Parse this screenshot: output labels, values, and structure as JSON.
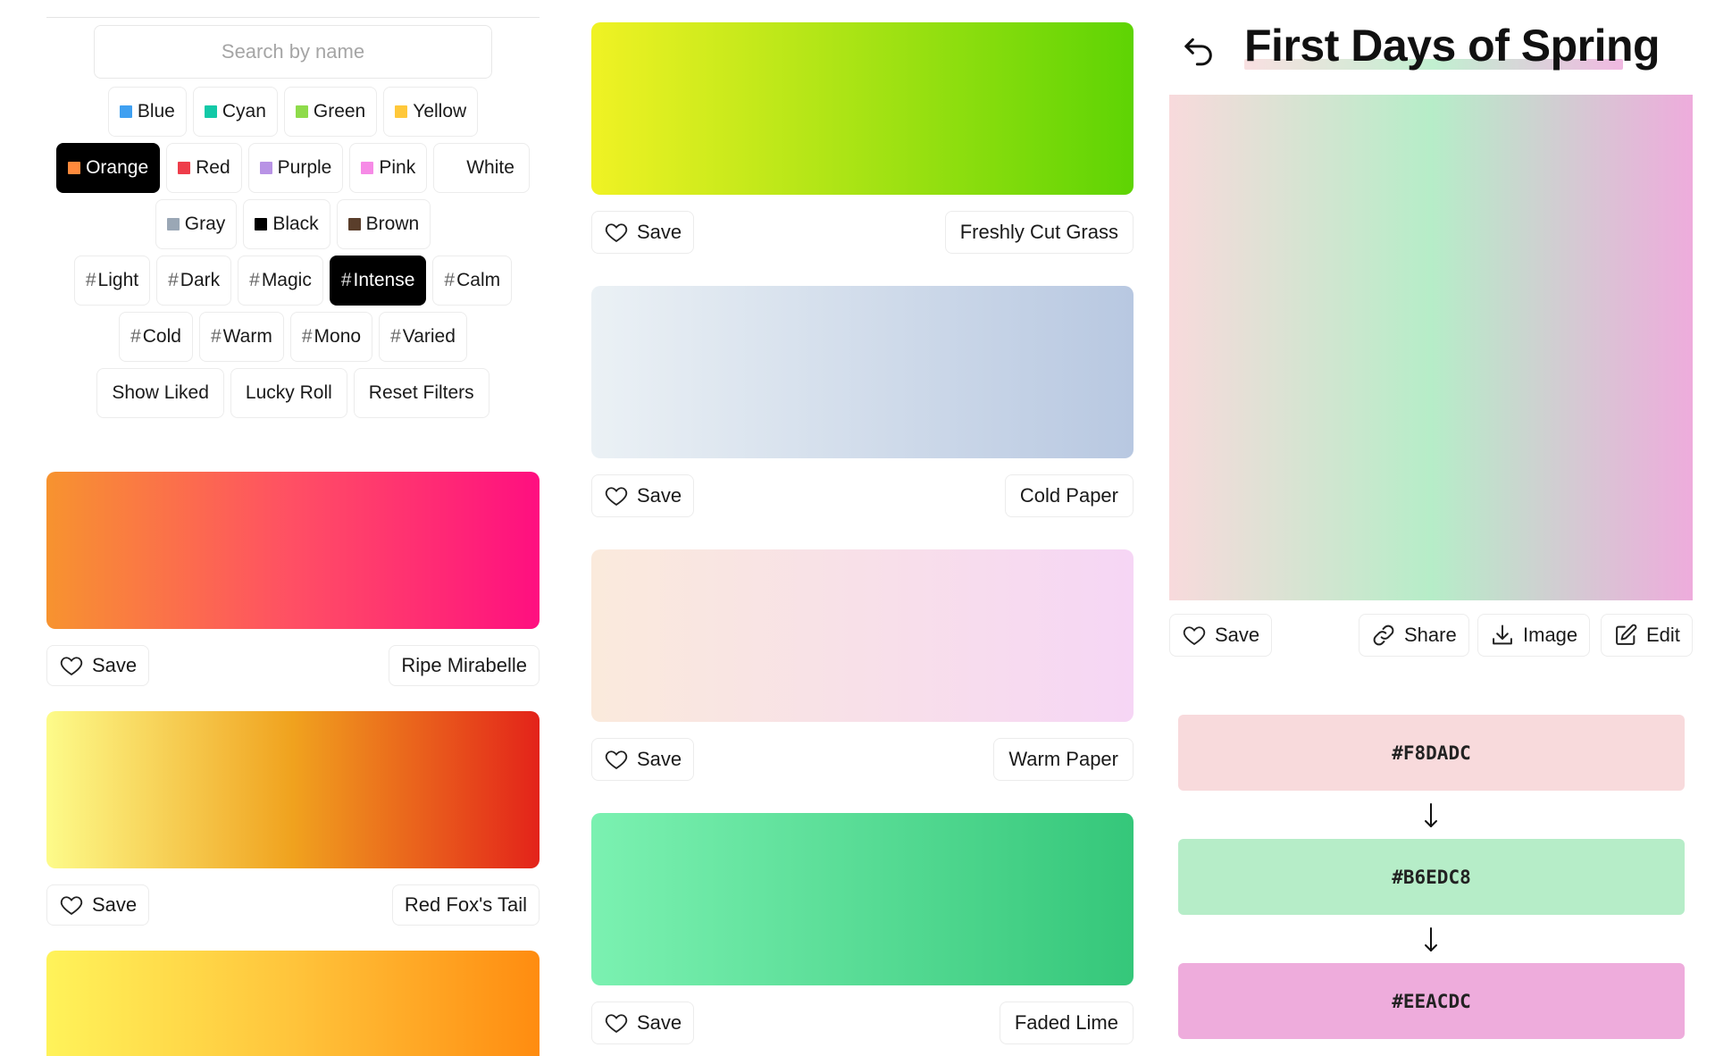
{
  "search": {
    "placeholder": "Search by name"
  },
  "colors": {
    "row1": [
      {
        "label": "Blue",
        "swatch": "#3fa0f1"
      },
      {
        "label": "Cyan",
        "swatch": "#12c9a7"
      },
      {
        "label": "Green",
        "swatch": "#8edb4a"
      },
      {
        "label": "Yellow",
        "swatch": "#ffc83a"
      }
    ],
    "row2": [
      {
        "label": "Orange",
        "swatch": "#ff8a3c",
        "active": true
      },
      {
        "label": "Red",
        "swatch": "#ee3d4a"
      },
      {
        "label": "Purple",
        "swatch": "#b893e5"
      },
      {
        "label": "Pink",
        "swatch": "#f68ae6"
      },
      {
        "label": "White",
        "swatch": "#ffffff"
      }
    ],
    "row3": [
      {
        "label": "Gray",
        "swatch": "#9aa7b5"
      },
      {
        "label": "Black",
        "swatch": "#000000"
      },
      {
        "label": "Brown",
        "swatch": "#5a3e2b"
      }
    ]
  },
  "tags": {
    "row1": [
      {
        "label": "Light"
      },
      {
        "label": "Dark"
      },
      {
        "label": "Magic"
      },
      {
        "label": "Intense",
        "active": true
      },
      {
        "label": "Calm"
      }
    ],
    "row2": [
      {
        "label": "Cold"
      },
      {
        "label": "Warm"
      },
      {
        "label": "Mono"
      },
      {
        "label": "Varied"
      }
    ],
    "hash": "#"
  },
  "actions": {
    "show_liked": "Show Liked",
    "lucky_roll": "Lucky Roll",
    "reset_filters": "Reset Filters"
  },
  "save_label": "Save",
  "left_gradients": [
    {
      "name": "Ripe Mirabelle",
      "colors": [
        "#f7932f",
        "#ff4f64",
        "#ff0f80"
      ]
    },
    {
      "name": "Red Fox's Tail",
      "colors": [
        "#fdfb8a",
        "#f0a21e",
        "#e3231a"
      ]
    },
    {
      "name": "",
      "colors": [
        "#fff35a",
        "#ffc43b",
        "#ff8c10"
      ]
    }
  ],
  "middle_gradients": [
    {
      "name": "Freshly Cut Grass",
      "colors": [
        "#f0f224",
        "#5ed404"
      ]
    },
    {
      "name": "Cold Paper",
      "colors": [
        "#ebf1f5",
        "#b8c8e1"
      ]
    },
    {
      "name": "Warm Paper",
      "colors": [
        "#faeadc",
        "#f6d6f5"
      ]
    },
    {
      "name": "Faded Lime",
      "colors": [
        "#7bf1b1",
        "#35c77a"
      ]
    }
  ],
  "detail": {
    "title": "First Days of Spring",
    "buttons": {
      "save": "Save",
      "share": "Share",
      "image": "Image",
      "edit": "Edit"
    },
    "stops": [
      "#F8DADC",
      "#B6EDC8",
      "#EEACDC"
    ],
    "arrow": "↓"
  },
  "icons": {
    "back": "undo-arrow-icon",
    "save": "heart-icon",
    "share": "link-icon",
    "image": "download-icon",
    "edit": "edit-icon"
  }
}
